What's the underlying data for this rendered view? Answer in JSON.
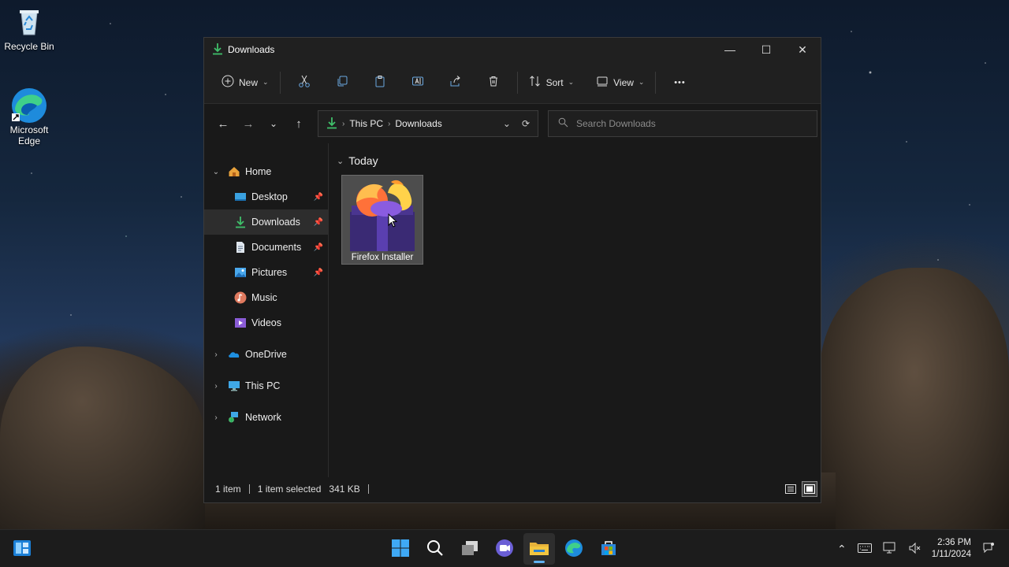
{
  "desktop": {
    "icons": [
      {
        "label": "Recycle Bin",
        "icon": "recycle-bin-icon"
      },
      {
        "label": "Microsoft Edge",
        "icon": "edge-icon"
      }
    ]
  },
  "window": {
    "title": "Downloads",
    "controls": {
      "minimize": "—",
      "maximize": "☐",
      "close": "✕"
    }
  },
  "toolbar": {
    "new_label": "New",
    "sort_label": "Sort",
    "view_label": "View",
    "more_label": "•••"
  },
  "address": {
    "segments": [
      "This PC",
      "Downloads"
    ],
    "search_placeholder": "Search Downloads"
  },
  "sidebar": {
    "items": [
      {
        "label": "Home",
        "expanded": true
      },
      {
        "label": "Desktop",
        "pinned": true
      },
      {
        "label": "Downloads",
        "pinned": true,
        "selected": true
      },
      {
        "label": "Documents",
        "pinned": true
      },
      {
        "label": "Pictures",
        "pinned": true
      },
      {
        "label": "Music"
      },
      {
        "label": "Videos"
      },
      {
        "label": "OneDrive",
        "expanded": false
      },
      {
        "label": "This PC",
        "expanded": false
      },
      {
        "label": "Network",
        "expanded": false
      }
    ]
  },
  "content": {
    "group_header": "Today",
    "files": [
      {
        "name": "Firefox Installer"
      }
    ]
  },
  "status": {
    "count": "1 item",
    "selection": "1 item selected",
    "size": "341 KB"
  },
  "taskbar": {
    "clock_time": "2:36 PM",
    "clock_date": "1/11/2024"
  },
  "colors": {
    "accent": "#5fb2f2",
    "download_green": "#3fbf6a",
    "folder_yellow": "#f3c53f"
  }
}
